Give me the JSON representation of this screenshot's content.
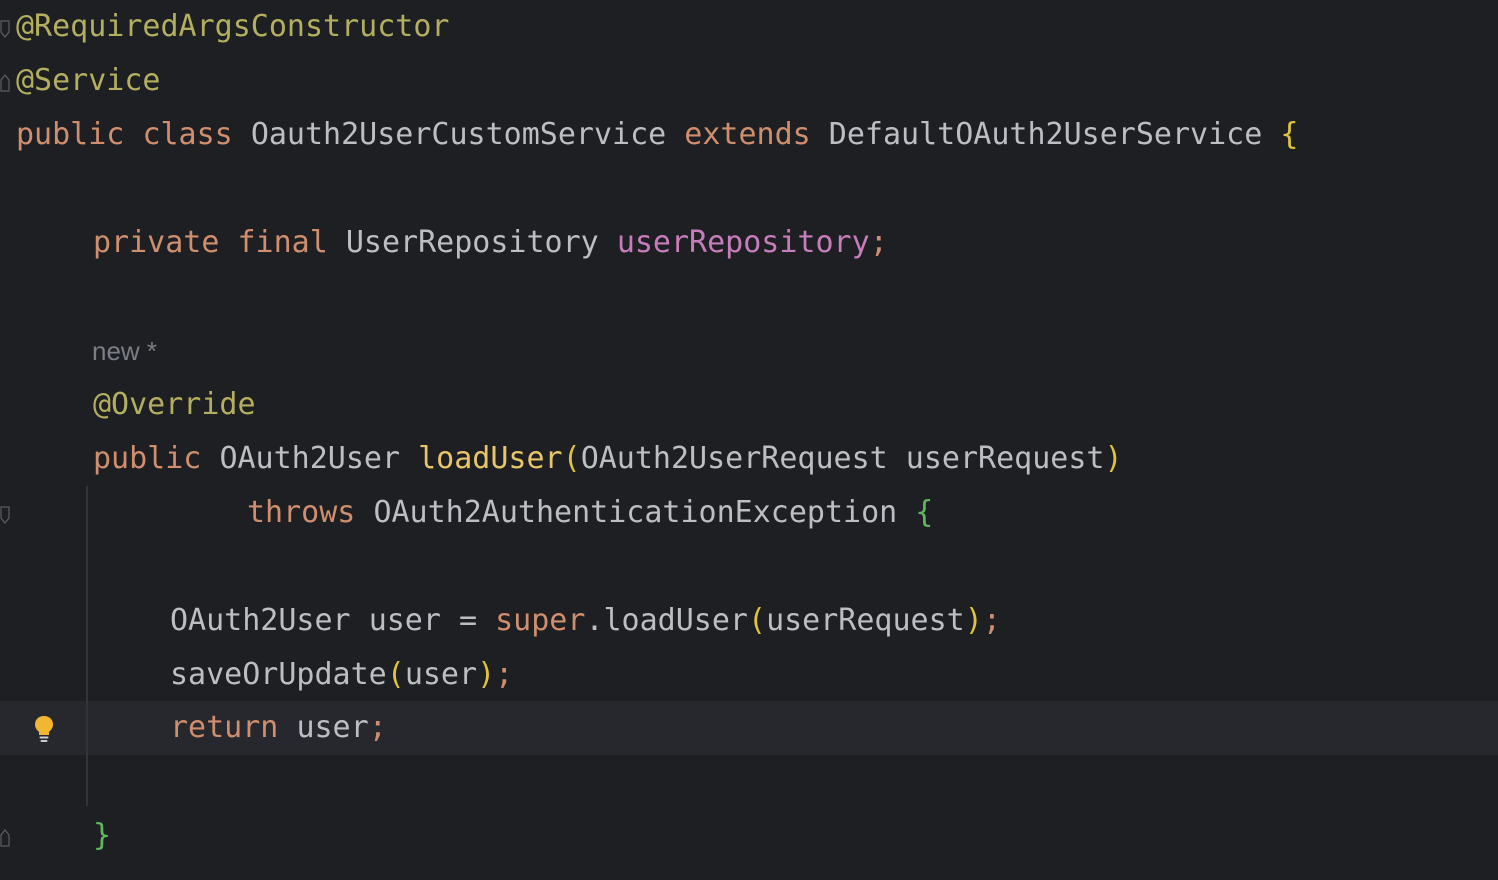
{
  "code": {
    "line1": {
      "ann": "@RequiredArgsConstructor"
    },
    "line2": {
      "ann": "@Service"
    },
    "line3": {
      "kw1": "public",
      "kw2": "class",
      "name": "Oauth2UserCustomService",
      "kw3": "extends",
      "parent": "DefaultOAuth2UserService",
      "brace": "{"
    },
    "line5": {
      "kw1": "private",
      "kw2": "final",
      "type": "UserRepository",
      "field": "userRepository",
      "semi": ";"
    },
    "inlay": {
      "text": "new *"
    },
    "line7": {
      "ann": "@Override"
    },
    "line8": {
      "kw": "public",
      "type": "OAuth2User",
      "method": "loadUser",
      "open": "(",
      "ptype": "OAuth2UserRequest",
      "pname": "userRequest",
      "close": ")"
    },
    "line9": {
      "kw": "throws",
      "exc": "OAuth2AuthenticationException",
      "brace": "{"
    },
    "line11": {
      "type": "OAuth2User",
      "var": "user",
      "eq": "=",
      "super": "super",
      "dot": ".loadUser",
      "open": "(",
      "arg": "userRequest",
      "close": ")",
      "semi": ";"
    },
    "line12": {
      "call": "saveOrUpdate",
      "open": "(",
      "arg": "user",
      "close": ")",
      "semi": ";"
    },
    "line13": {
      "kw": "return",
      "var": "user",
      "semi": ";"
    },
    "line15": {
      "brace": "}"
    }
  },
  "colors": {
    "background": "#1e1f22",
    "annotation": "#b3ae60",
    "keyword": "#cf8e6d",
    "field": "#c77dbb",
    "method_decl": "#e8c46a",
    "brace_block": "#5fb760"
  },
  "icons": {
    "bulb": "intention-bulb-icon",
    "fold": "fold-marker-icon"
  }
}
